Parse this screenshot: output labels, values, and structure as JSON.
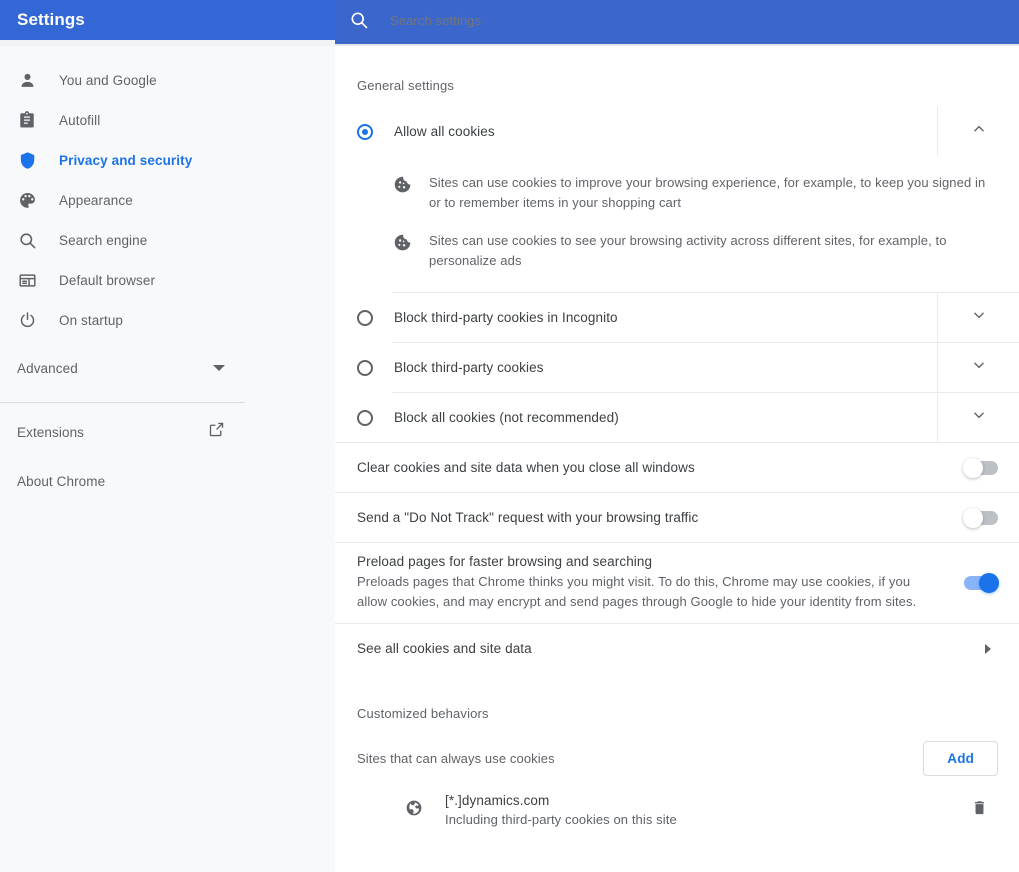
{
  "header": {
    "title": "Settings",
    "search_placeholder": "Search settings",
    "search_value": "",
    "search_icon": "search-icon",
    "bar_color": "#3367d6",
    "search_bar_color": "#3b67cc"
  },
  "sidebar": {
    "items": [
      {
        "label": "You and Google",
        "icon": "person-icon",
        "active": false
      },
      {
        "label": "Autofill",
        "icon": "clipboard-icon",
        "active": false
      },
      {
        "label": "Privacy and security",
        "icon": "shield-icon",
        "active": true
      },
      {
        "label": "Appearance",
        "icon": "palette-icon",
        "active": false
      },
      {
        "label": "Search engine",
        "icon": "search-icon",
        "active": false
      },
      {
        "label": "Default browser",
        "icon": "browser-window-icon",
        "active": false
      },
      {
        "label": "On startup",
        "icon": "power-icon",
        "active": false
      }
    ],
    "advanced": {
      "label": "Advanced",
      "icon": "caret-down-icon"
    },
    "extensions": {
      "label": "Extensions",
      "icon": "external-link-icon"
    },
    "about": {
      "label": "About Chrome"
    },
    "active_color": "#1a73e8",
    "background": "#f8f9fa"
  },
  "main": {
    "general_settings_heading": "General settings",
    "cookie_options": [
      {
        "label": "Allow all cookies",
        "selected": true,
        "expand_icon": "chevron-up-icon",
        "descriptions": [
          {
            "icon": "cookie-icon",
            "text": "Sites can use cookies to improve your browsing experience, for example, to keep you signed in or to remember items in your shopping cart"
          },
          {
            "icon": "cookie-icon",
            "text": "Sites can use cookies to see your browsing activity across different sites, for example, to personalize ads"
          }
        ]
      },
      {
        "label": "Block third-party cookies in Incognito",
        "selected": false,
        "expand_icon": "chevron-down-icon",
        "descriptions": []
      },
      {
        "label": "Block third-party cookies",
        "selected": false,
        "expand_icon": "chevron-down-icon",
        "descriptions": []
      },
      {
        "label": "Block all cookies (not recommended)",
        "selected": false,
        "expand_icon": "chevron-down-icon",
        "descriptions": []
      }
    ],
    "toggles": [
      {
        "title": "Clear cookies and site data when you close all windows",
        "subtitle": "",
        "on": false
      },
      {
        "title": "Send a \"Do Not Track\" request with your browsing traffic",
        "subtitle": "",
        "on": false
      },
      {
        "title": "Preload pages for faster browsing and searching",
        "subtitle": "Preloads pages that Chrome thinks you might visit. To do this, Chrome may use cookies, if you allow cookies, and may encrypt and send pages through Google to hide your identity from sites.",
        "on": true
      }
    ],
    "see_all": {
      "label": "See all cookies and site data",
      "icon": "arrow-right-icon"
    },
    "customized_behaviors_heading": "Customized behaviors",
    "always_allow": {
      "label": "Sites that can always use cookies",
      "add_button": "Add",
      "sites": [
        {
          "icon": "globe-icon",
          "name": "[*.]dynamics.com",
          "subtitle": "Including third-party cookies on this site",
          "delete_icon": "trash-icon"
        }
      ]
    }
  }
}
